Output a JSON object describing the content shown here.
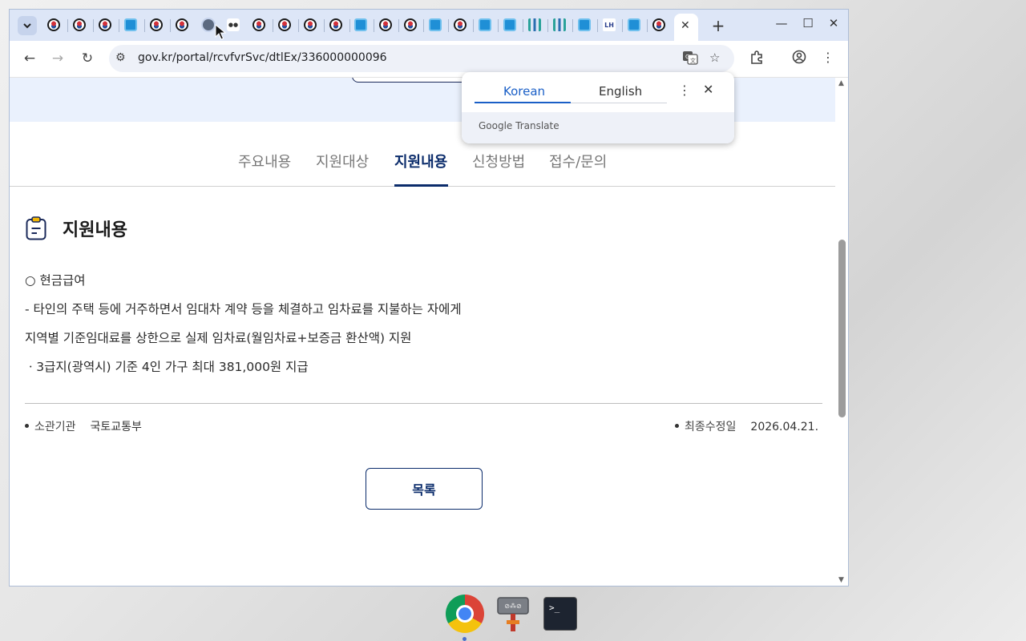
{
  "browser": {
    "url": "gov.kr/portal/rcvfvrSvc/dtlEx/336000000096",
    "tabs_active_close": "✕"
  },
  "subnav": {
    "items": [
      "주요내용",
      "지원대상",
      "지원내용",
      "신청방법",
      "접수/문의"
    ],
    "active_index": 2
  },
  "section": {
    "title": "지원내용",
    "lines": [
      "○ 현금급여",
      "- 타인의 주택 등에 거주하면서 임대차 계약 등을 체결하고 임차료를 지불하는 자에게",
      "지역별 기준임대료를 상한으로 실제 임차료(월임차료+보증금 환산액) 지원",
      "ㆍ3급지(광역시) 기준 4인 가구 최대 381,000원 지급"
    ]
  },
  "meta": {
    "agency_label": "소관기관",
    "agency_value": "국토교통부",
    "updated_label": "최종수정일",
    "updated_value": "2026.04.21."
  },
  "list_button": "목록",
  "translate_popup": {
    "tab_source": "Korean",
    "tab_target": "English",
    "brand": "Google Translate"
  },
  "taskbar": {
    "terminal_glyph": ">_"
  },
  "colors": {
    "accent_navy": "#0b2c6b",
    "translate_blue": "#1a5fc7",
    "tabstrip": "#dde6f7",
    "hero": "#eaf1fd"
  }
}
